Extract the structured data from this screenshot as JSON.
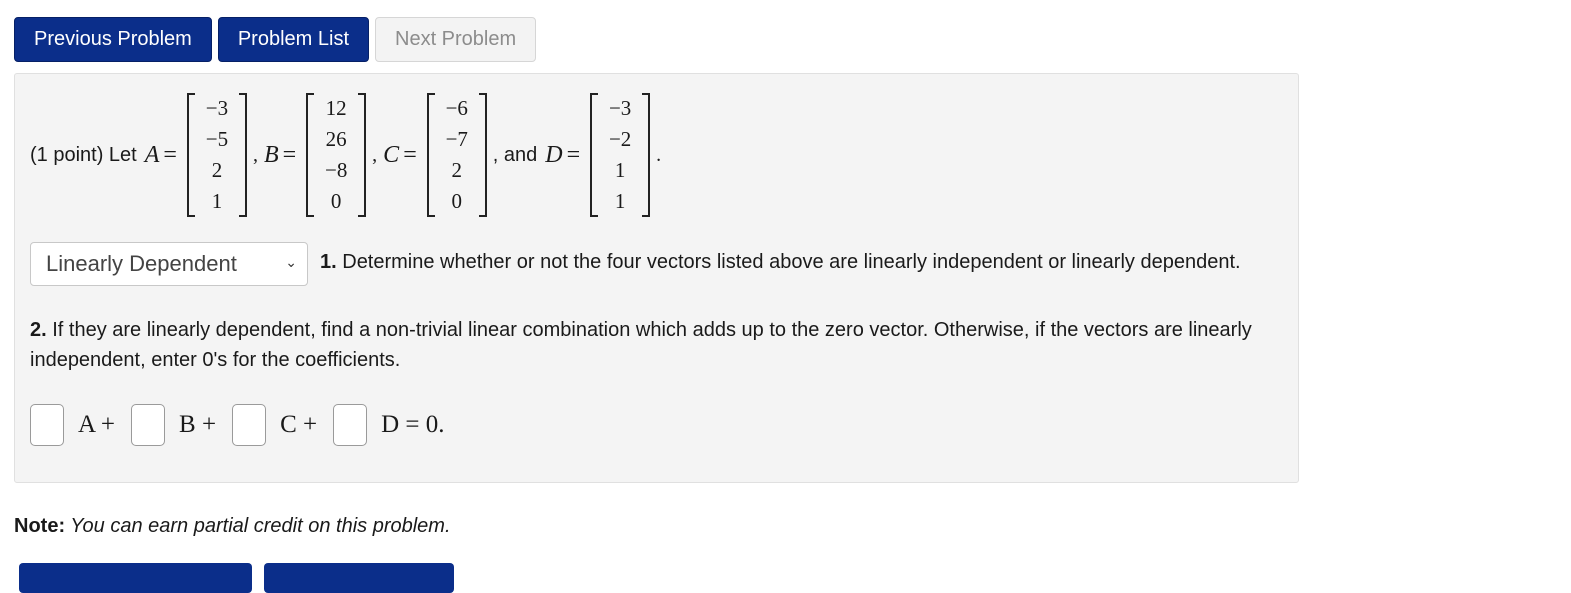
{
  "nav": {
    "previous": "Previous Problem",
    "list": "Problem List",
    "next": "Next Problem"
  },
  "problem": {
    "intro": "(1 point) Let",
    "matrices": {
      "A": {
        "name": "A",
        "entries": [
          "−3",
          "−5",
          "2",
          "1"
        ]
      },
      "B": {
        "name": "B",
        "entries": [
          "12",
          "26",
          "−8",
          "0"
        ]
      },
      "C": {
        "name": "C",
        "entries": [
          "−6",
          "−7",
          "2",
          "0"
        ]
      },
      "D": {
        "name": "D",
        "entries": [
          "−3",
          "−2",
          "1",
          "1"
        ]
      }
    },
    "equals": "=",
    "comma": ",",
    "and_text": ", and",
    "period": ".",
    "select_value": "Linearly Dependent",
    "q1_num": "1.",
    "q1_text": " Determine whether or not the four vectors listed above are linearly independent or linearly dependent.",
    "q2_num": "2.",
    "q2_text": " If they are linearly dependent, find a non-trivial linear combination which adds up to the zero vector. Otherwise, if the vectors are linearly independent, enter 0's for the coefficients.",
    "combo_terms": [
      "A +",
      "B +",
      "C +",
      "D = 0."
    ]
  },
  "note": {
    "label": "Note:",
    "text": " You can earn partial credit on this problem."
  }
}
